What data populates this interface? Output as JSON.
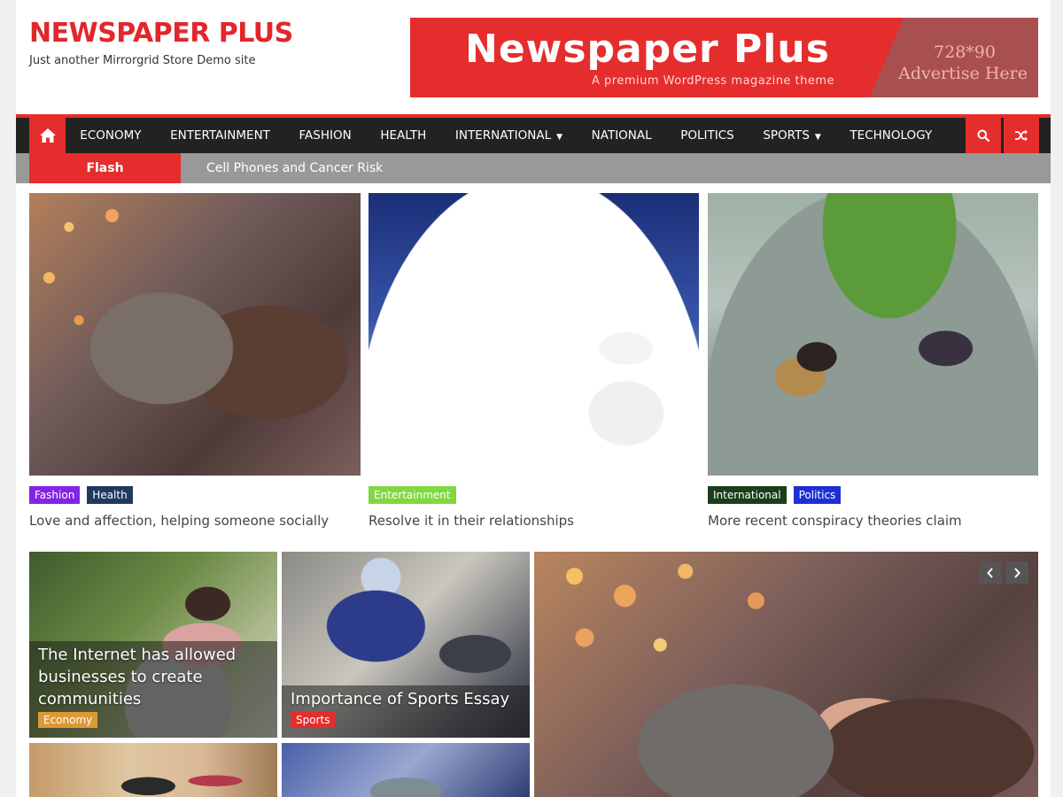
{
  "header": {
    "site_title": "NEWSPAPER PLUS",
    "tagline": "Just another Mirrorgrid Store Demo site"
  },
  "banner": {
    "title": "Newspaper Plus",
    "subtitle": "A premium WordPress magazine theme",
    "size": "728*90",
    "advertise": "Advertise Here"
  },
  "nav": {
    "home_icon": "home-icon",
    "items": [
      {
        "label": "ECONOMY"
      },
      {
        "label": "ENTERTAINMENT"
      },
      {
        "label": "FASHION"
      },
      {
        "label": "HEALTH"
      },
      {
        "label": "INTERNATIONAL",
        "dropdown": true
      },
      {
        "label": "NATIONAL"
      },
      {
        "label": "POLITICS"
      },
      {
        "label": "SPORTS",
        "dropdown": true
      },
      {
        "label": "TECHNOLOGY"
      }
    ],
    "search_icon": "search-icon",
    "random_icon": "shuffle-icon"
  },
  "ticker": {
    "label": "Flash",
    "headline": "Cell Phones and Cancer Risk"
  },
  "featured": [
    {
      "tags": [
        {
          "label": "Fashion",
          "color": "#8224e3"
        },
        {
          "label": "Health",
          "color": "#1e3a5f"
        }
      ],
      "title": "Love and affection, helping someone socially"
    },
    {
      "tags": [
        {
          "label": "Entertainment",
          "color": "#81d742"
        }
      ],
      "title": "Resolve it in their relationships"
    },
    {
      "tags": [
        {
          "label": "International",
          "color": "#1a3d1a"
        },
        {
          "label": "Politics",
          "color": "#1e2fd6"
        }
      ],
      "title": "More recent conspiracy theories claim"
    }
  ],
  "grid": [
    {
      "title": "The Internet has allowed businesses to create communities",
      "tag": {
        "label": "Economy",
        "color": "#dd9933"
      }
    },
    {
      "title": "Importance of Sports Essay",
      "tag": {
        "label": "Sports",
        "color": "#e52d2d"
      }
    }
  ],
  "colors": {
    "accent": "#e52d2d",
    "nav_bg": "#222222",
    "ticker_bg": "#999999"
  }
}
